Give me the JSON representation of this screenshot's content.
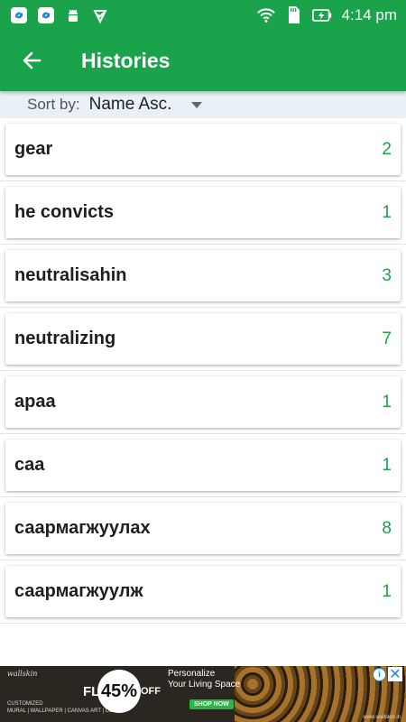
{
  "status_bar": {
    "time": "4:14 pm",
    "icons_left": [
      "sync-icon",
      "sync-icon",
      "android-icon",
      "download-check-icon"
    ],
    "icons_right": [
      "wifi-icon",
      "sd-card-icon",
      "battery-charging-icon"
    ]
  },
  "app_bar": {
    "title": "Histories",
    "back_icon": "arrow-left-icon",
    "color": "#1aa34a"
  },
  "sort": {
    "label": "Sort by:",
    "value": "Name Asc."
  },
  "histories": [
    {
      "word": "gear",
      "count": "2"
    },
    {
      "word": "he convicts",
      "count": "1"
    },
    {
      "word": "neutralisahin",
      "count": "3"
    },
    {
      "word": "neutralizing",
      "count": "7"
    },
    {
      "word": "apaa",
      "count": "1"
    },
    {
      "word": "caa",
      "count": "1"
    },
    {
      "word": "саармагжуулах",
      "count": "8"
    },
    {
      "word": "саармагжуулж",
      "count": "1"
    }
  ],
  "ad": {
    "brand": "wallskin",
    "flat": "FLAT",
    "percent": "45%",
    "off": "OFF",
    "tagline_1": "Personalize",
    "tagline_2": "Your Living Space",
    "customized": "CUSTOMIZED",
    "categories": "MURAL | WALLPAPER | CANVAS ART | DECAL",
    "shop_now": "SHOP NOW",
    "url": "www.wallskin.in"
  }
}
